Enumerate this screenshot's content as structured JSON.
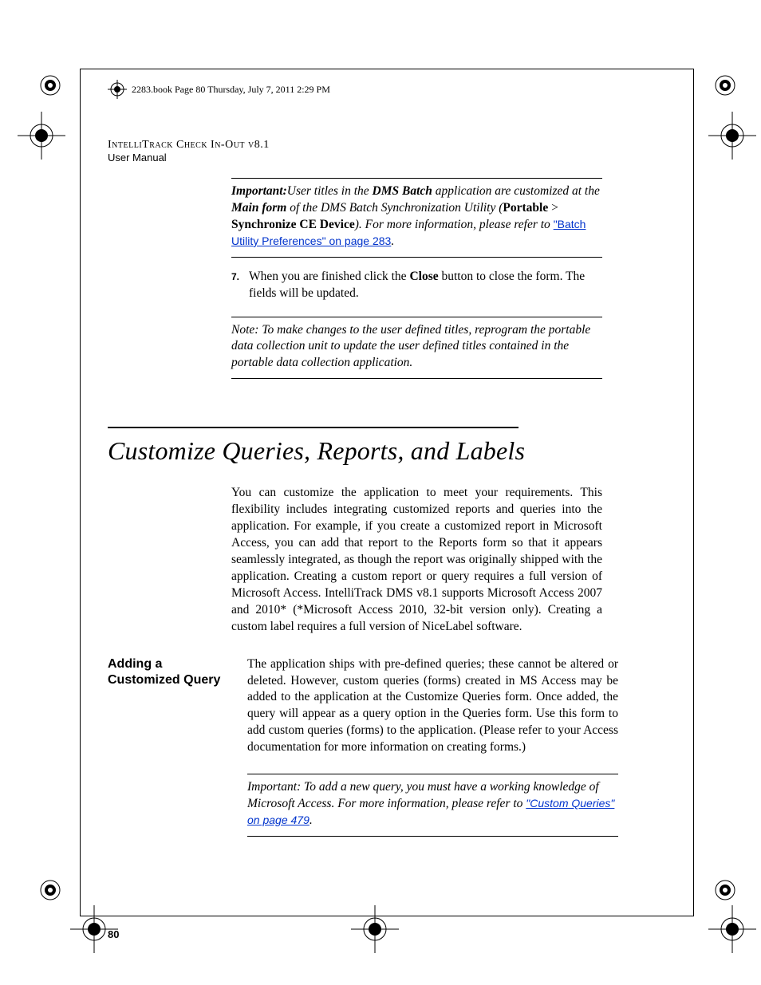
{
  "crop_line": "2283.book  Page 80  Thursday, July 7, 2011  2:29 PM",
  "header": {
    "title": "IntelliTrack Check In-Out v8.1",
    "subtitle": "User Manual"
  },
  "important1": {
    "lead": "Important:",
    "t1": "User titles in the ",
    "b1": "DMS Batch",
    "t2": " application are customized at the ",
    "b2": "Main form",
    "t3": " of the DMS Batch Synchronization Utility (",
    "b3": "Portable",
    "gt": " > ",
    "b4": "Synchronize CE Device",
    "t4": "). For more information, please refer to ",
    "link": "\"Batch Utility Preferences\" on page 283",
    "end": "."
  },
  "step7": {
    "num": "7.",
    "t1": "When you are finished click the ",
    "b1": "Close",
    "t2": " button to close the form. The fields will be updated."
  },
  "note": {
    "lead": "Note:",
    "body": "   To make changes to the user defined titles, reprogram the portable data collection unit to update the user defined titles contained in the portable data collection application."
  },
  "section_title": "Customize Queries, Reports, and Labels",
  "intro": "You can customize the application to meet your requirements. This flexibility includes integrating customized reports and queries into the application. For example, if you create a customized report in Microsoft Access, you can add that report to the Reports form so that it appears seamlessly integrated, as though the report was originally shipped with the application. Creating a custom report or query requires a full version of Microsoft Access. IntelliTrack DMS v8.1 supports Microsoft Access 2007 and 2010* (*Microsoft Access 2010, 32-bit version only). Creating a custom label requires a full version of NiceLabel software.",
  "side_heading": "Adding a Customized Query",
  "addq": "The application ships with pre-defined queries; these cannot be altered or deleted. However, custom queries (forms) created in MS Access may be added to the application at the Customize Queries form. Once added, the query will appear as a query option in the Queries form. Use this form to add custom queries (forms) to the application. (Please refer to your Access documentation for more information on creating forms.)",
  "important2": {
    "lead": "Important:",
    "body": "   To add a new query, you must have a working knowledge of Microsoft Access. For more information, please refer to ",
    "link": "\"Custom Queries\" on page 479",
    "end": "."
  },
  "page_number": "80"
}
